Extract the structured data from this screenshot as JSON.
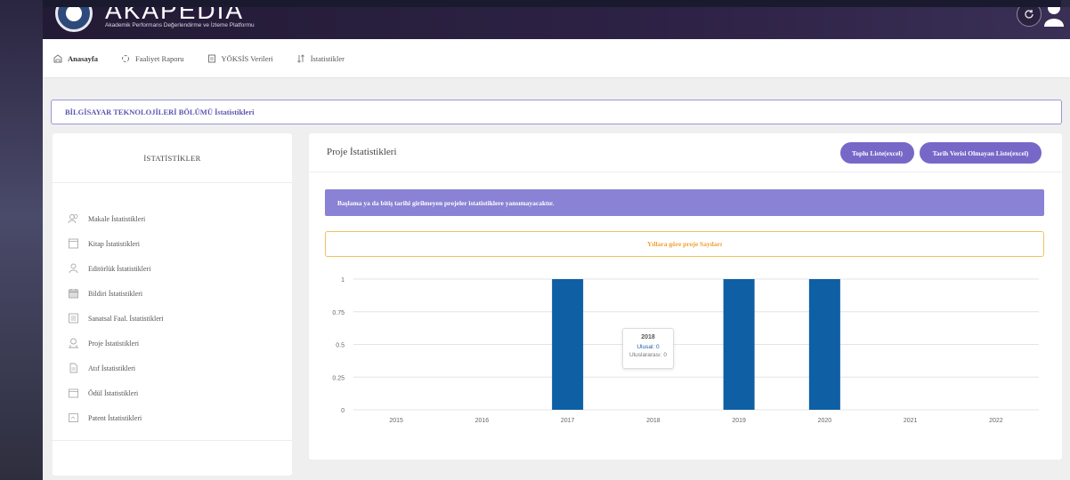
{
  "header": {
    "logo_title": "AKAPEDIA",
    "logo_subtitle": "Akademik Performans Değerlendirme ve İzleme Platformu"
  },
  "nav": {
    "items": [
      {
        "label": "Anasayfa",
        "icon": "home-icon"
      },
      {
        "label": "Faaliyet Raporu",
        "icon": "spinner-icon"
      },
      {
        "label": "YÖKSİS Verileri",
        "icon": "document-icon"
      },
      {
        "label": "İstatistikler",
        "icon": "sort-icon"
      }
    ]
  },
  "breadcrumb": "BİLGİSAYAR TEKNOLOJİLERİ BÖLÜMÜ İstatistikleri",
  "sidebar": {
    "title": "İSTATİSTİKLER",
    "items": [
      {
        "label": "Makale İstatistikleri",
        "icon": "users-icon"
      },
      {
        "label": "Kitap İstatistikleri",
        "icon": "book-icon"
      },
      {
        "label": "Editörlük İstatistikleri",
        "icon": "user-icon"
      },
      {
        "label": "Bildiri İstatistikleri",
        "icon": "calendar-icon"
      },
      {
        "label": "Sanatsal Faal. İstatistikleri",
        "icon": "list-icon"
      },
      {
        "label": "Proje İstatistikleri",
        "icon": "project-icon"
      },
      {
        "label": "Atıf İstatistikleri",
        "icon": "file-icon"
      },
      {
        "label": "Ödül İstatistikleri",
        "icon": "folder-icon"
      },
      {
        "label": "Patent İstatistikleri",
        "icon": "patent-icon"
      }
    ]
  },
  "main": {
    "title": "Proje İstatistikleri",
    "btn_all": "Toplu Liste(excel)",
    "btn_nodate": "Tarih Verisi Olmayan Liste(excel)",
    "alert": "Başlama ya da bitiş tarihi girilmeyen projeler istatistiklere yansımayacaktır.",
    "chart_heading": "Yıllara göre proje Sayıları"
  },
  "tooltip": {
    "year": "2018",
    "national": "Ulusal: 0",
    "international": "Uluslararası: 0"
  },
  "colors": {
    "accent": "#7768c8",
    "bar": "#0f5fa4",
    "warning": "#f0a030"
  },
  "chart_data": {
    "type": "bar",
    "categories": [
      "2015",
      "2016",
      "2017",
      "2018",
      "2019",
      "2020",
      "2021",
      "2022"
    ],
    "values": [
      0,
      0,
      1,
      0,
      1,
      1,
      0,
      0
    ],
    "yticks": [
      "0",
      "0.25",
      "0.5",
      "0.75",
      "1"
    ],
    "ylim": [
      0,
      1
    ],
    "grid": true
  }
}
